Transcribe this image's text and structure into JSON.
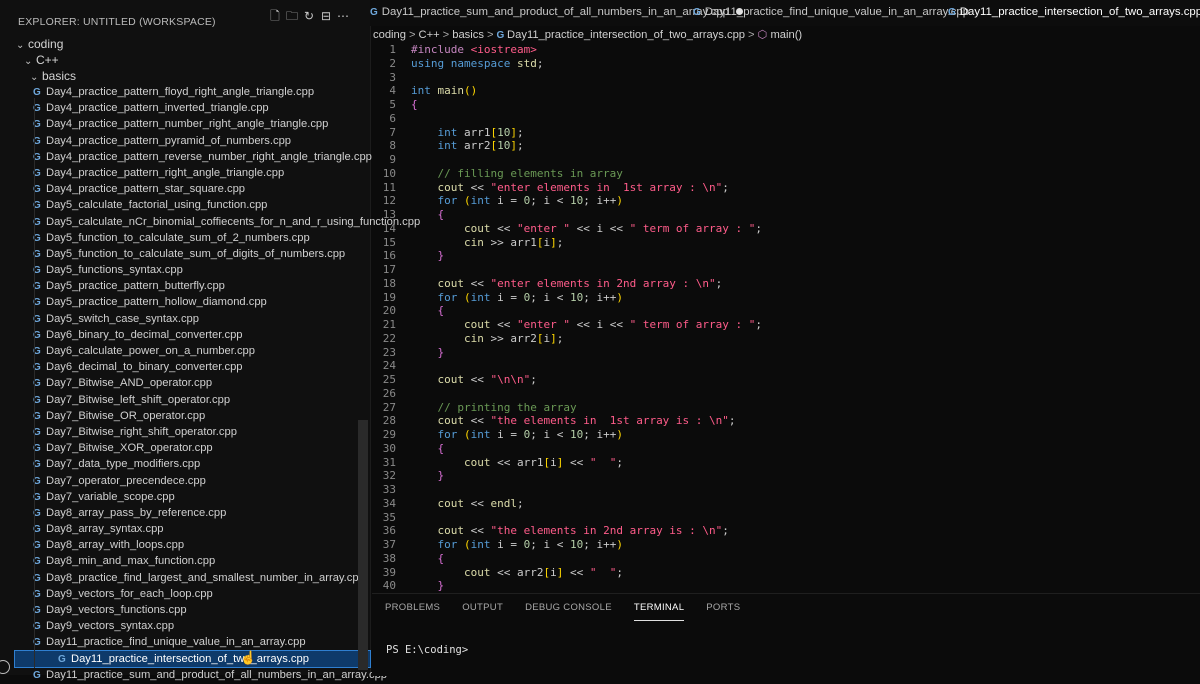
{
  "explorer": {
    "title": "EXPLORER: UNTITLED (WORKSPACE)",
    "actions": [
      "new-file-icon",
      "new-folder-icon",
      "refresh-icon",
      "collapse-all-icon",
      "more-icon"
    ],
    "folders": {
      "root": "coding",
      "lang": "C++",
      "sub": "basics"
    },
    "files": [
      "Day4_practice_pattern_floyd_right_angle_triangle.cpp",
      "Day4_practice_pattern_inverted_triangle.cpp",
      "Day4_practice_pattern_number_right_angle_triangle.cpp",
      "Day4_practice_pattern_pyramid_of_numbers.cpp",
      "Day4_practice_pattern_reverse_number_right_angle_triangle.cpp",
      "Day4_practice_pattern_right_angle_triangle.cpp",
      "Day4_practice_pattern_star_square.cpp",
      "Day5_calculate_factorial_using_function.cpp",
      "Day5_calculate_nCr_binomial_coffiecents_for_n_and_r_using_function.cpp",
      "Day5_function_to_calculate_sum_of_2_numbers.cpp",
      "Day5_function_to_calculate_sum_of_digits_of_numbers.cpp",
      "Day5_functions_syntax.cpp",
      "Day5_practice_pattern_butterfly.cpp",
      "Day5_practice_pattern_hollow_diamond.cpp",
      "Day5_switch_case_syntax.cpp",
      "Day6_binary_to_decimal_converter.cpp",
      "Day6_calculate_power_on_a_number.cpp",
      "Day6_decimal_to_binary_converter.cpp",
      "Day7_Bitwise_AND_operator.cpp",
      "Day7_Bitwise_left_shift_operator.cpp",
      "Day7_Bitwise_OR_operator.cpp",
      "Day7_Bitwise_right_shift_operator.cpp",
      "Day7_Bitwise_XOR_operator.cpp",
      "Day7_data_type_modifiers.cpp",
      "Day7_operator_precendece.cpp",
      "Day7_variable_scope.cpp",
      "Day8_array_pass_by_reference.cpp",
      "Day8_array_syntax.cpp",
      "Day8_array_with_loops.cpp",
      "Day8_min_and_max_function.cpp",
      "Day8_practice_find_largest_and_smallest_number_in_array.cpp",
      "Day9_vectors_for_each_loop.cpp",
      "Day9_vectors_functions.cpp",
      "Day9_vectors_syntax.cpp",
      "Day11_practice_find_unique_value_in_an_array.cpp",
      "Day11_practice_intersection_of_two_arrays.cpp",
      "Day11_practice_sum_and_product_of_all_numbers_in_an_array.cpp"
    ],
    "selected_file": "Day11_practice_intersection_of_two_arrays.cpp"
  },
  "tabs": [
    {
      "label": "Day11_practice_sum_and_product_of_all_numbers_in_an_array.cpp",
      "modified": true
    },
    {
      "label": "Day11_practice_find_unique_value_in_an_array.cpp",
      "modified": false
    },
    {
      "label": "Day11_practice_intersection_of_two_arrays.cpp",
      "active": true,
      "close": "×"
    }
  ],
  "breadcrumb": {
    "parts": [
      "coding",
      "C++",
      "basics",
      "Day11_practice_intersection_of_two_arrays.cpp",
      "main()"
    ],
    "separator": ">"
  },
  "code": [
    {
      "n": "1",
      "t": "#include <iostream>"
    },
    {
      "n": "2",
      "t": "using namespace std;"
    },
    {
      "n": "3",
      "t": ""
    },
    {
      "n": "4",
      "t": "int main()"
    },
    {
      "n": "5",
      "t": "{"
    },
    {
      "n": "6",
      "t": ""
    },
    {
      "n": "7",
      "t": "    int arr1[10];"
    },
    {
      "n": "8",
      "t": "    int arr2[10];"
    },
    {
      "n": "9",
      "t": ""
    },
    {
      "n": "10",
      "t": "    // filling elements in array"
    },
    {
      "n": "11",
      "t": "    cout << \"enter elements in  1st array : \\n\";"
    },
    {
      "n": "12",
      "t": "    for (int i = 0; i < 10; i++)"
    },
    {
      "n": "13",
      "t": "    {"
    },
    {
      "n": "14",
      "t": "        cout << \"enter \" << i << \" term of array : \";"
    },
    {
      "n": "15",
      "t": "        cin >> arr1[i];"
    },
    {
      "n": "16",
      "t": "    }"
    },
    {
      "n": "17",
      "t": ""
    },
    {
      "n": "18",
      "t": "    cout << \"enter elements in 2nd array : \\n\";"
    },
    {
      "n": "19",
      "t": "    for (int i = 0; i < 10; i++)"
    },
    {
      "n": "20",
      "t": "    {"
    },
    {
      "n": "21",
      "t": "        cout << \"enter \" << i << \" term of array : \";"
    },
    {
      "n": "22",
      "t": "        cin >> arr2[i];"
    },
    {
      "n": "23",
      "t": "    }"
    },
    {
      "n": "24",
      "t": ""
    },
    {
      "n": "25",
      "t": "    cout << \"\\n\\n\";"
    },
    {
      "n": "26",
      "t": ""
    },
    {
      "n": "27",
      "t": "    // printing the array"
    },
    {
      "n": "28",
      "t": "    cout << \"the elements in  1st array is : \\n\";"
    },
    {
      "n": "29",
      "t": "    for (int i = 0; i < 10; i++)"
    },
    {
      "n": "30",
      "t": "    {"
    },
    {
      "n": "31",
      "t": "        cout << arr1[i] << \"  \";"
    },
    {
      "n": "32",
      "t": "    }"
    },
    {
      "n": "33",
      "t": ""
    },
    {
      "n": "34",
      "t": "    cout << endl;"
    },
    {
      "n": "35",
      "t": ""
    },
    {
      "n": "36",
      "t": "    cout << \"the elements in 2nd array is : \\n\";"
    },
    {
      "n": "37",
      "t": "    for (int i = 0; i < 10; i++)"
    },
    {
      "n": "38",
      "t": "    {"
    },
    {
      "n": "39",
      "t": "        cout << arr2[i] << \"  \";"
    },
    {
      "n": "40",
      "t": "    }"
    }
  ],
  "panel": {
    "tabs": [
      "PROBLEMS",
      "OUTPUT",
      "DEBUG CONSOLE",
      "TERMINAL",
      "PORTS"
    ],
    "active_tab": "TERMINAL",
    "prompt": "PS E:\\coding>"
  },
  "colors": {
    "accent": "#2f7fd0",
    "selection": "#0e3a6a",
    "string": "#ff5c8a",
    "keyword": "#569cd6",
    "comment": "#6a9955"
  }
}
